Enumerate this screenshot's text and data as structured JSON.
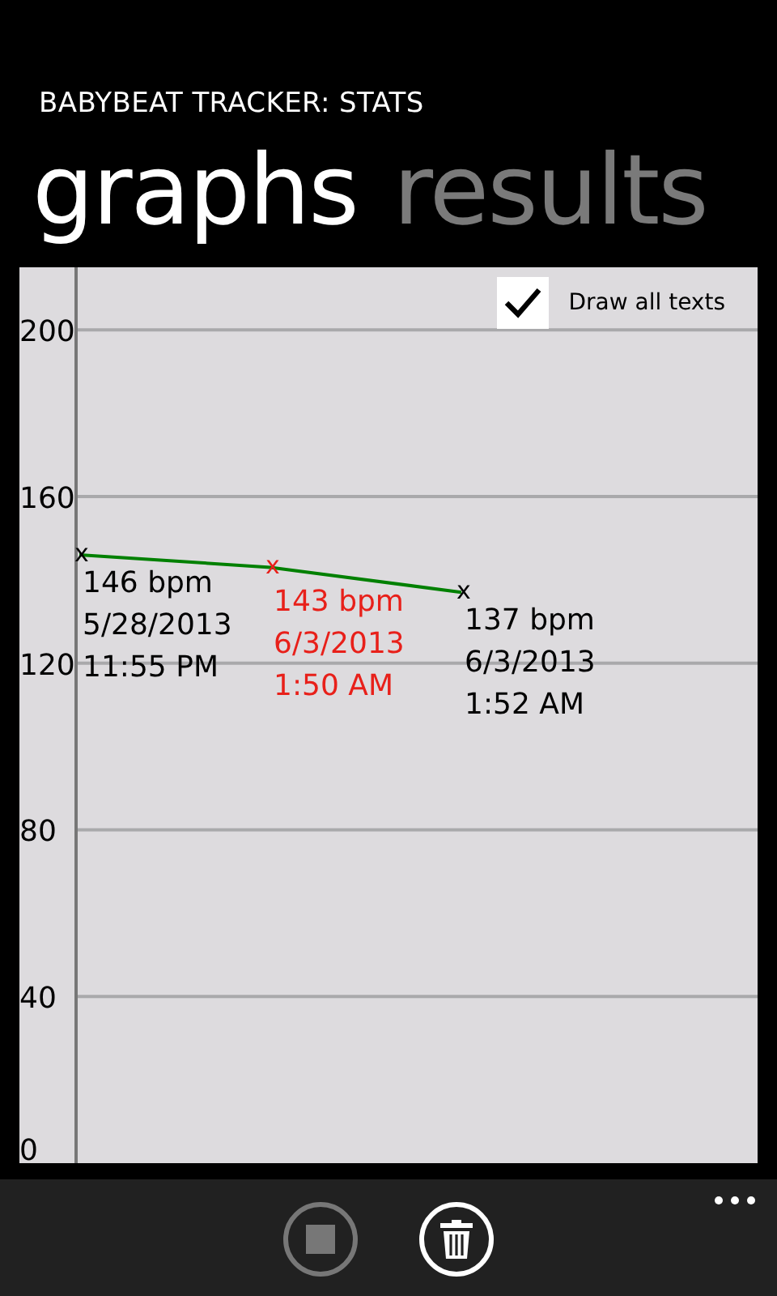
{
  "app_title": "BABYBEAT TRACKER: STATS",
  "pivot": [
    {
      "label": "graphs",
      "selected": true
    },
    {
      "label": "results",
      "selected": false
    }
  ],
  "graph": {
    "option": {
      "label": "Draw all texts",
      "checked": true
    },
    "chart_data": {
      "type": "line",
      "ylim": [
        0,
        215
      ],
      "yticks": [
        0,
        40,
        80,
        120,
        160,
        200
      ],
      "grid": true,
      "series": [
        {
          "color": "#008000",
          "values": [
            146,
            143,
            137
          ]
        }
      ]
    },
    "points": [
      {
        "marker": "x",
        "selected": false,
        "lines": [
          "146 bpm",
          "5/28/2013",
          "11:55 PM"
        ]
      },
      {
        "marker": "x",
        "selected": true,
        "lines": [
          "143 bpm",
          "6/3/2013",
          "1:50 AM"
        ]
      },
      {
        "marker": "x",
        "selected": false,
        "lines": [
          "137 bpm",
          "6/3/2013",
          "1:52 AM"
        ]
      }
    ]
  },
  "app_bar": {
    "buttons": [
      {
        "kind": "stop",
        "disabled": true
      },
      {
        "kind": "delete",
        "disabled": false
      }
    ]
  }
}
